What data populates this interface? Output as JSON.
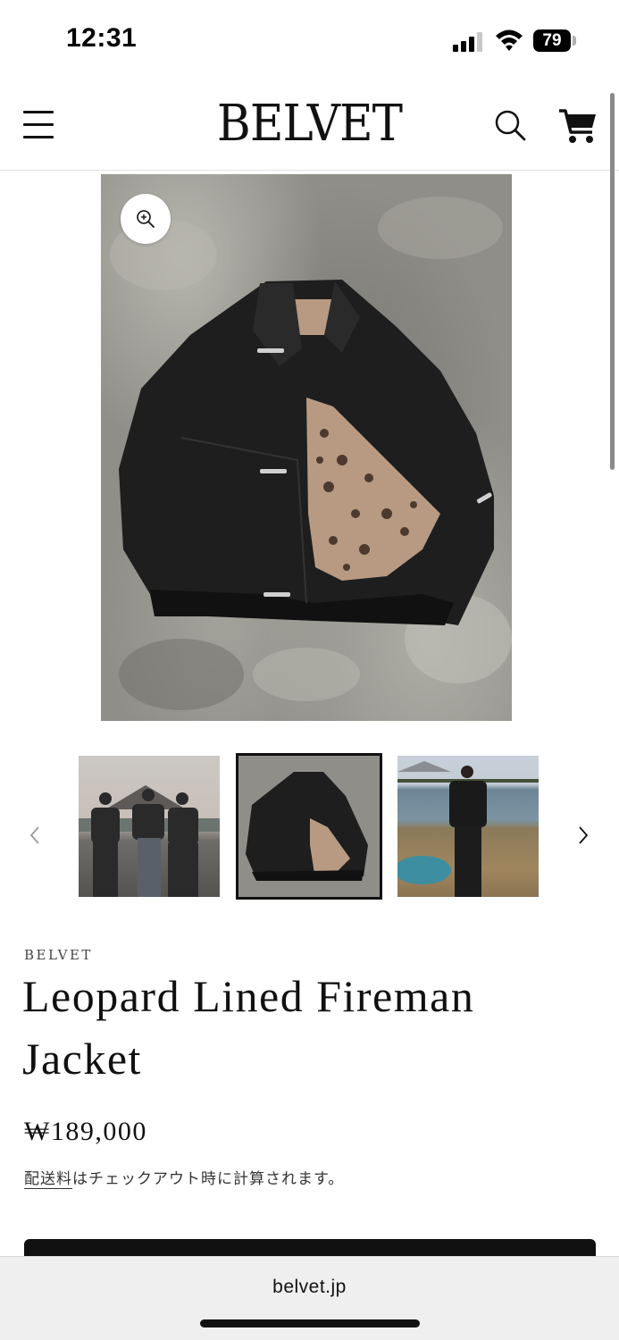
{
  "status_bar": {
    "time": "12:31",
    "battery": "79"
  },
  "header": {
    "logo": "BELVET"
  },
  "product": {
    "vendor": "BELVET",
    "title": "Leopard Lined Fireman Jacket",
    "price": "₩189,000",
    "shipping_link": "配送料",
    "shipping_rest": "はチェックアウト時に計算されます。"
  },
  "gallery": {
    "selected_index": 1,
    "thumbnail_count": 3
  },
  "browser": {
    "url": "belvet.jp"
  },
  "colors": {
    "text": "#111111",
    "button": "#111111",
    "browser_bar": "#efefef"
  }
}
